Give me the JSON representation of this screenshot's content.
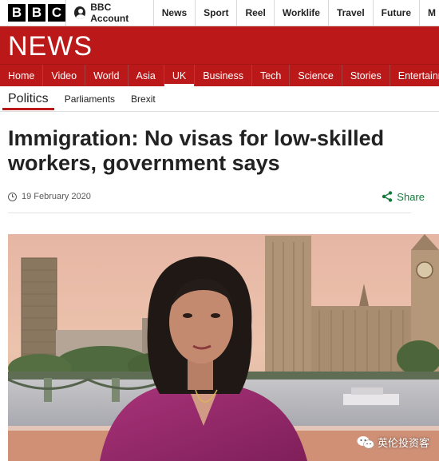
{
  "brand": {
    "letters": [
      "B",
      "B",
      "C"
    ],
    "news_logo": "NEWS"
  },
  "account": {
    "label": "BBC Account"
  },
  "top_nav": [
    "News",
    "Sport",
    "Reel",
    "Worklife",
    "Travel",
    "Future",
    "M"
  ],
  "section_nav": {
    "items": [
      "Home",
      "Video",
      "World",
      "Asia",
      "UK",
      "Business",
      "Tech",
      "Science",
      "Stories",
      "Entertainment &"
    ],
    "active": "UK"
  },
  "sub_nav": {
    "primary": "Politics",
    "items": [
      "Parliaments",
      "Brexit"
    ]
  },
  "article": {
    "headline": "Immigration: No visas for low-skilled workers, government says",
    "date": "19 February 2020",
    "share_label": "Share"
  },
  "watermark": {
    "text": "英伦投资客"
  },
  "colors": {
    "news_red": "#bb1919",
    "share_green": "#117a3a",
    "underline_red": "#bb1919"
  },
  "icons": {
    "account": "user-icon",
    "date": "clock-icon",
    "share": "share-icon",
    "watermark": "wechat-icon"
  }
}
